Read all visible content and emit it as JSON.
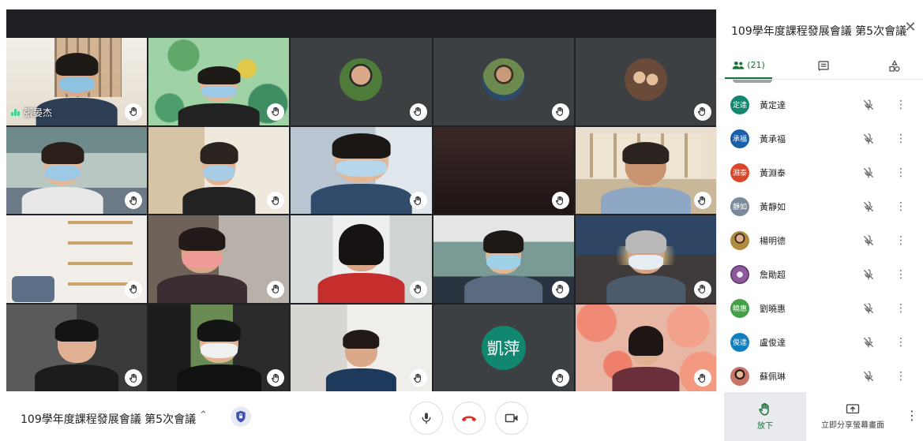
{
  "meeting": {
    "title": "109學年度課程發展會議 第5次會議"
  },
  "grid": {
    "tiles": [
      {
        "id": 1,
        "label": "張晏杰",
        "speaking": true,
        "hand_icon": "raise-hand-icon"
      },
      {
        "id": 2,
        "hand_icon": "raise-hand-icon"
      },
      {
        "id": 3,
        "hand_icon": "raise-hand-icon"
      },
      {
        "id": 4,
        "hand_icon": "raise-hand-icon"
      },
      {
        "id": 5,
        "hand_icon": "raise-hand-icon"
      },
      {
        "id": 6,
        "hand_icon": "raise-hand-icon"
      },
      {
        "id": 7,
        "hand_icon": "raise-hand-icon"
      },
      {
        "id": 8,
        "hand_icon": "raise-hand-icon"
      },
      {
        "id": 9,
        "hand_icon": "raise-hand-icon"
      },
      {
        "id": 10,
        "hand_icon": "raise-hand-icon"
      },
      {
        "id": 11,
        "hand_icon": "raise-hand-icon"
      },
      {
        "id": 12,
        "hand_icon": "raise-hand-icon"
      },
      {
        "id": 13,
        "hand_icon": "raise-hand-icon"
      },
      {
        "id": 14,
        "hand_icon": "raise-hand-icon"
      },
      {
        "id": 15,
        "hand_icon": "raise-hand-icon"
      },
      {
        "id": 16,
        "hand_icon": "raise-hand-icon"
      },
      {
        "id": 17,
        "hand_icon": "raise-hand-icon"
      },
      {
        "id": 18,
        "hand_icon": "raise-hand-icon"
      },
      {
        "id": 19,
        "initials": "凱萍",
        "hand_icon": "raise-hand-icon"
      },
      {
        "id": 20,
        "hand_icon": "raise-hand-icon"
      }
    ]
  },
  "panel": {
    "title": "109學年度課程發展會議 第5次會議",
    "close_icon": "close-icon",
    "tabs": {
      "people_count": "(21)",
      "people_icon": "people-icon",
      "chat_icon": "chat-icon",
      "activities_icon": "activities-icon"
    },
    "participants": [
      {
        "name": "黃定達",
        "initials": "定達",
        "color": "#12876f"
      },
      {
        "name": "黃承福",
        "initials": "承福",
        "color": "#1a5fa8"
      },
      {
        "name": "黃淵泰",
        "initials": "淵泰",
        "color": "#d8472a"
      },
      {
        "name": "黃靜如",
        "initials": "靜如",
        "color": "#7b8a9a"
      },
      {
        "name": "楊明德",
        "initials": "",
        "color": "#b08a3e"
      },
      {
        "name": "詹勛超",
        "initials": "",
        "color": "#8e5a9c"
      },
      {
        "name": "劉曉惠",
        "initials": "曉惠",
        "color": "#43a047"
      },
      {
        "name": "盧俊達",
        "initials": "俊達",
        "color": "#0f7fbf"
      },
      {
        "name": "蘇佩琳",
        "initials": "",
        "color": "#c9756b"
      }
    ]
  },
  "controls": {
    "mic_icon": "microphone-icon",
    "hangup_icon": "hang-up-icon",
    "camera_icon": "camera-icon",
    "raise_hand_label": "放下",
    "present_label": "立即分享螢幕畫面",
    "more_icon": "more-vert-icon",
    "security_icon": "shield-icon",
    "chevron_icon": "chevron-up-icon"
  },
  "colors": {
    "accent_green": "#137333",
    "tile_dark": "#202124",
    "hangup_red": "#d93025"
  }
}
